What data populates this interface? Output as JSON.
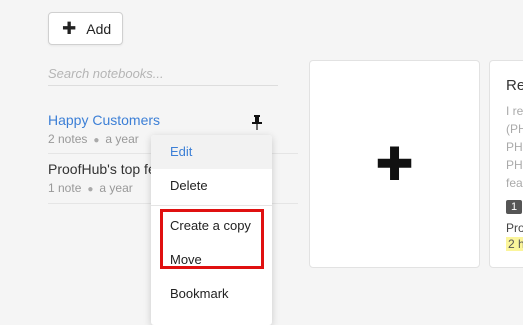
{
  "toolbar": {
    "add_label": "Add",
    "add_icon": "plus-icon"
  },
  "search": {
    "placeholder": "Search notebooks..."
  },
  "notebooks": [
    {
      "title": "Happy Customers",
      "notes": "2 notes",
      "age": "a year",
      "pinned": true,
      "accent": "#3c7fd6"
    },
    {
      "title": "ProofHub's top fe",
      "notes": "1 note",
      "age": "a year"
    }
  ],
  "context_menu": {
    "items": [
      {
        "label": "Edit",
        "active": true
      },
      {
        "label": "Delete"
      },
      {
        "label": "Create a copy"
      },
      {
        "label": "Move"
      },
      {
        "label": "Bookmark"
      }
    ],
    "highlight_color": "#e01010"
  },
  "new_card": {
    "icon": "plus-icon"
  },
  "preview_card": {
    "title": "Re",
    "lines": [
      "I re",
      "(PH",
      "PH",
      "PH",
      "fea"
    ],
    "badge": "1",
    "owner": "Proo",
    "time": "2 h"
  }
}
